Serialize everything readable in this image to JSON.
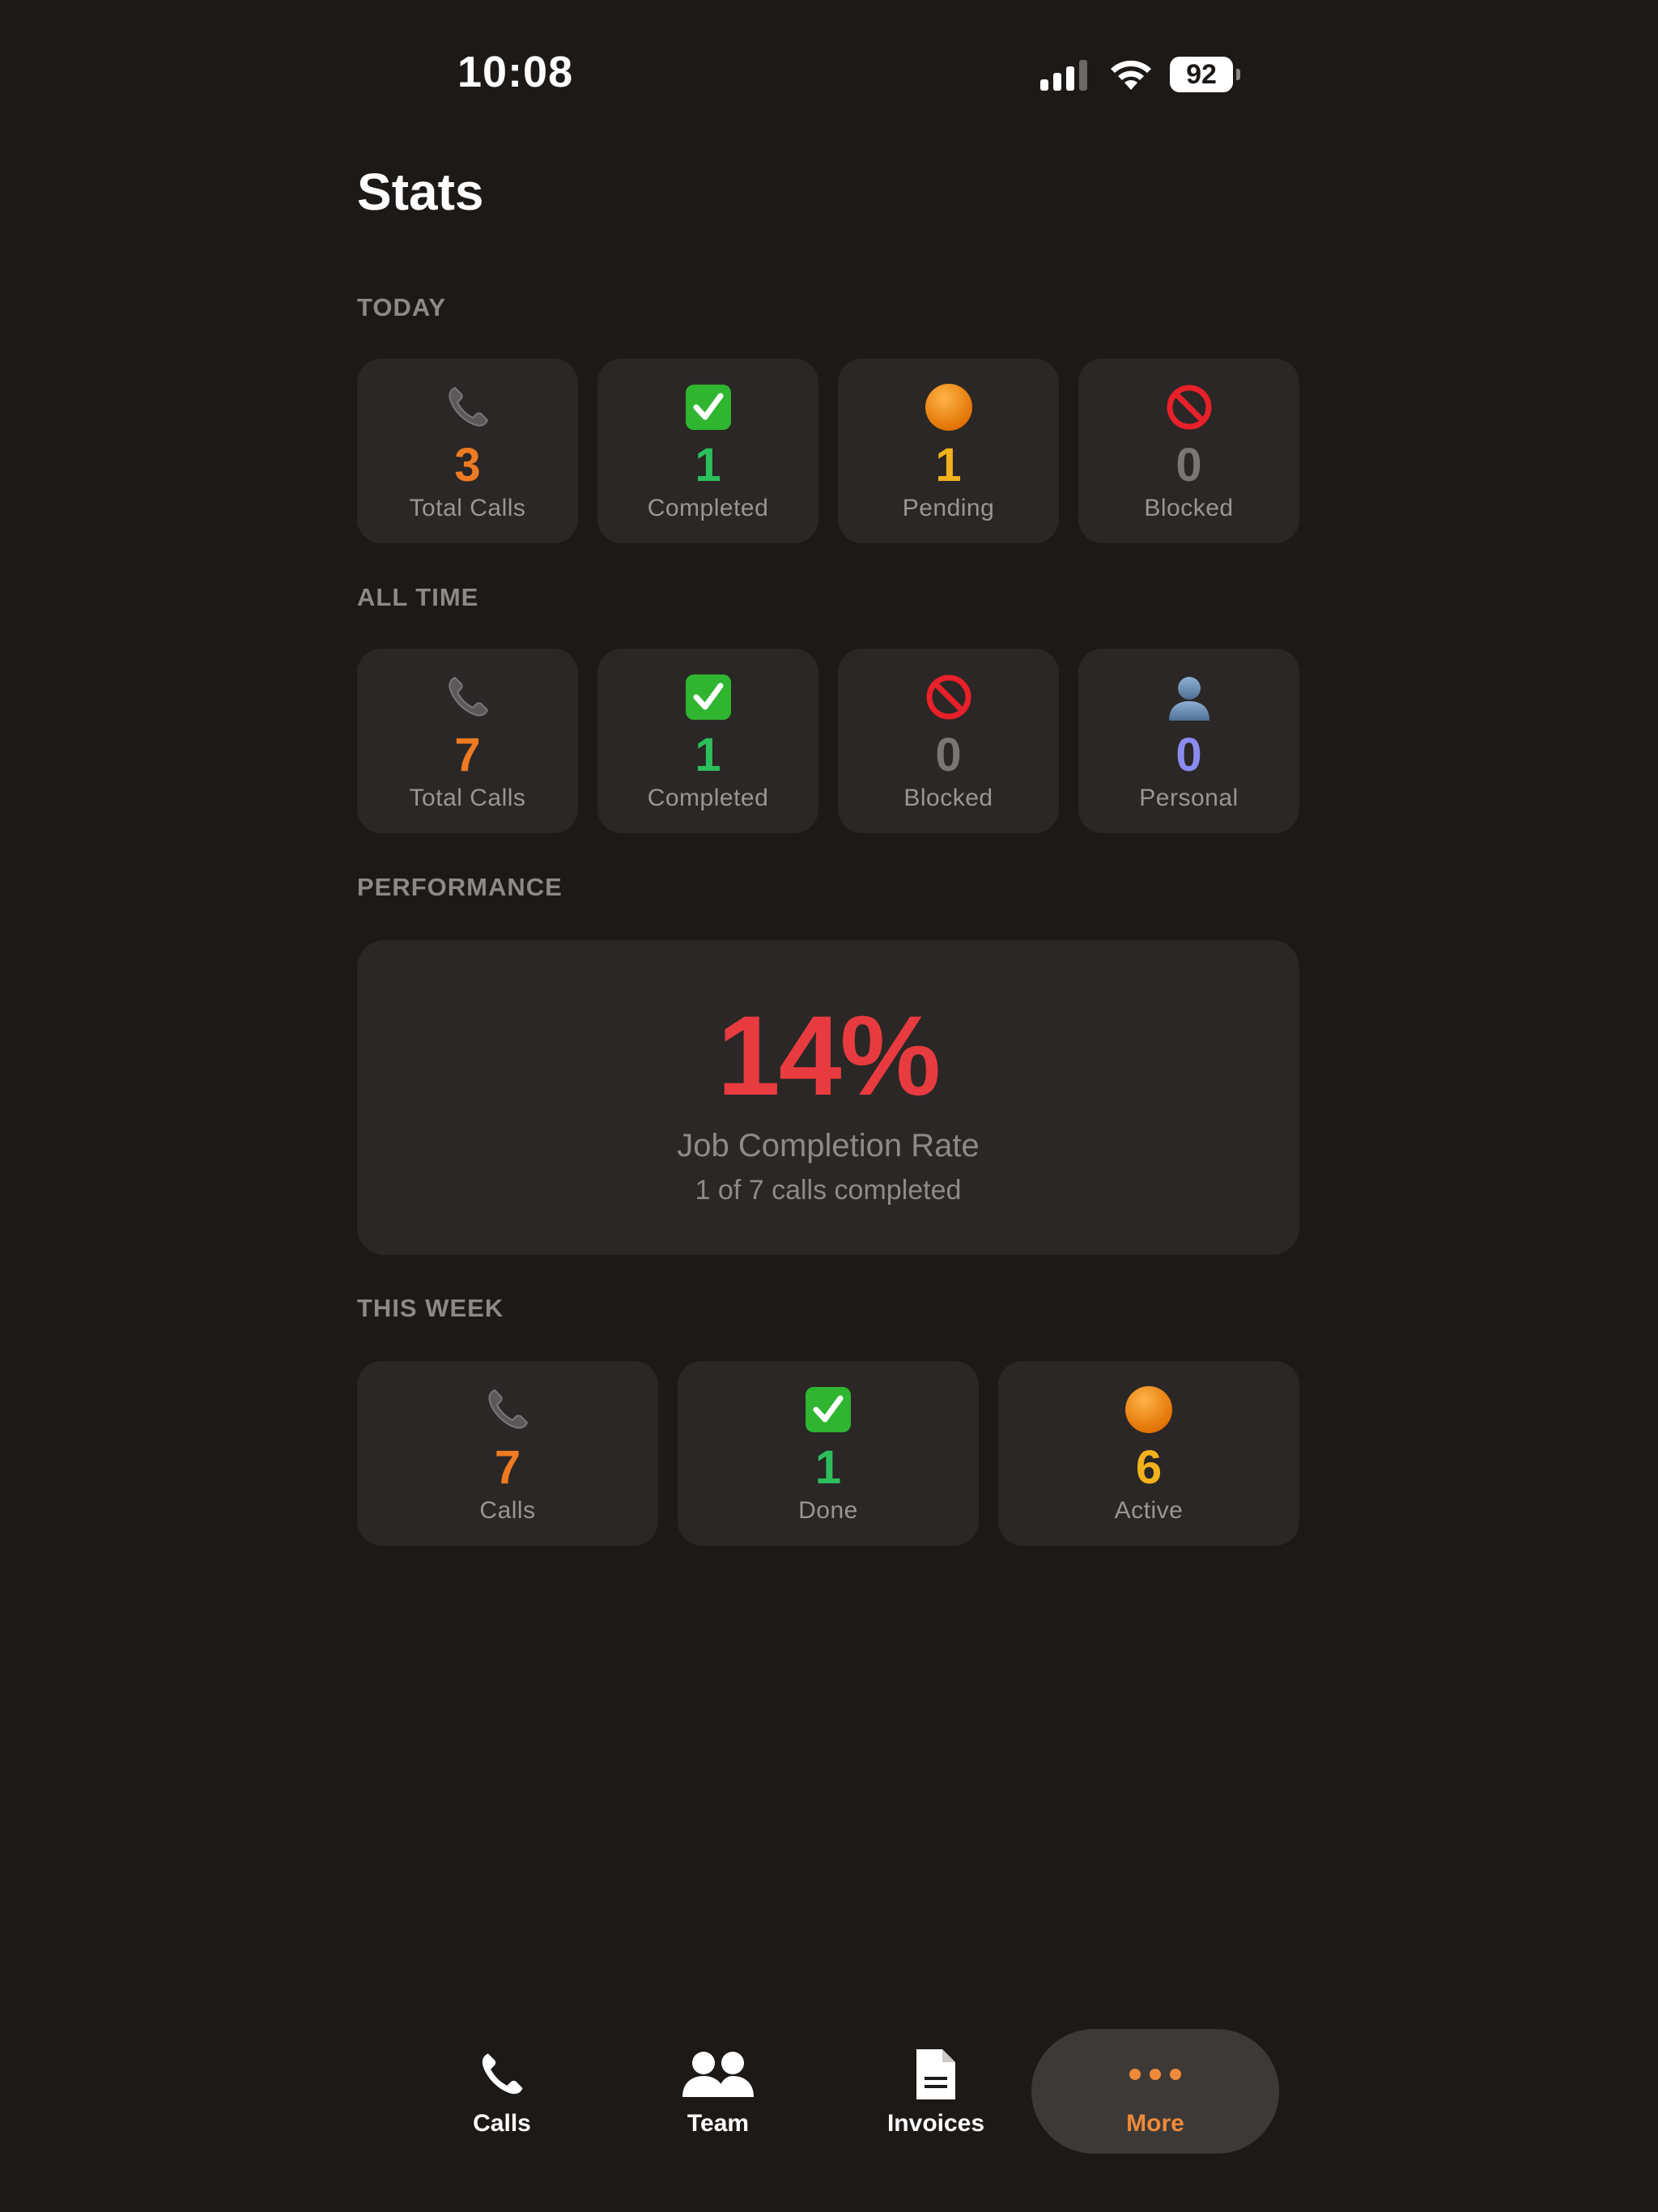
{
  "status_bar": {
    "time": "10:08",
    "battery": "92"
  },
  "header": {
    "title": "Stats"
  },
  "sections": {
    "today": {
      "label": "TODAY",
      "cards": [
        {
          "icon": "phone-icon",
          "value": "3",
          "label": "Total Calls",
          "color": "#ef7a22"
        },
        {
          "icon": "check-icon",
          "value": "1",
          "label": "Completed",
          "color": "#2dbe5c"
        },
        {
          "icon": "orange-circle-icon",
          "value": "1",
          "label": "Pending",
          "color": "#f2b21c"
        },
        {
          "icon": "blocked-icon",
          "value": "0",
          "label": "Blocked",
          "color": "#7a7674"
        }
      ]
    },
    "all_time": {
      "label": "ALL TIME",
      "cards": [
        {
          "icon": "phone-icon",
          "value": "7",
          "label": "Total Calls",
          "color": "#ef7a22"
        },
        {
          "icon": "check-icon",
          "value": "1",
          "label": "Completed",
          "color": "#2dbe5c"
        },
        {
          "icon": "blocked-icon",
          "value": "0",
          "label": "Blocked",
          "color": "#7a7674"
        },
        {
          "icon": "person-icon",
          "value": "0",
          "label": "Personal",
          "color": "#8a8cf0"
        }
      ]
    },
    "performance": {
      "label": "PERFORMANCE",
      "value": "14%",
      "title": "Job Completion Rate",
      "subtitle": "1 of 7 calls completed"
    },
    "this_week": {
      "label": "THIS WEEK",
      "cards": [
        {
          "icon": "phone-icon",
          "value": "7",
          "label": "Calls",
          "color": "#ef7a22"
        },
        {
          "icon": "check-icon",
          "value": "1",
          "label": "Done",
          "color": "#2dbe5c"
        },
        {
          "icon": "orange-circle-icon",
          "value": "6",
          "label": "Active",
          "color": "#f2b21c"
        }
      ]
    }
  },
  "tabbar": {
    "calls": "Calls",
    "team": "Team",
    "invoices": "Invoices",
    "more": "More",
    "active": "More"
  }
}
